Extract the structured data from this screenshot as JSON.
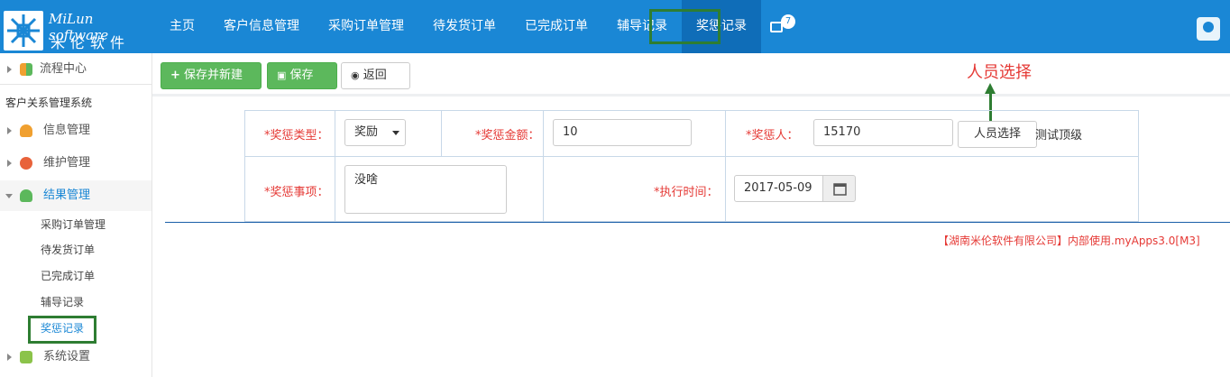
{
  "header": {
    "logo_en": "MiLun software",
    "logo_cn": "米伦软件",
    "nav": [
      "主页",
      "客户信息管理",
      "采购订单管理",
      "待发货订单",
      "已完成订单",
      "辅导记录",
      "奖惩记录"
    ],
    "badge_count": "7"
  },
  "sidebar": {
    "top_item": "流程中心",
    "section_title": "客户关系管理系统",
    "items": [
      "信息管理",
      "维护管理",
      "结果管理"
    ],
    "sub_items": [
      "采购订单管理",
      "待发货订单",
      "已完成订单",
      "辅导记录",
      "奖惩记录"
    ],
    "bottom_item": "系统设置"
  },
  "toolbar": {
    "save_new": "保存并新建",
    "save": "保存",
    "back": "返回"
  },
  "annotation": "人员选择",
  "form": {
    "type_label": "*奖惩类型：",
    "type_value": "奖励",
    "amount_label": "*奖惩金额：",
    "amount_value": "10",
    "person_label": "*奖惩人：",
    "person_value": "15170",
    "person_button": "人员选择",
    "person_name": "测试顶级",
    "matter_label": "*奖惩事项：",
    "matter_value": "没啥",
    "time_label": "*执行时间：",
    "time_value": "2017-05-09"
  },
  "footer": "【湖南米伦软件有限公司】内部使用.myApps3.0[M3]",
  "colors": {
    "topbar": "#1a87d5",
    "accent_green": "#5cb85c",
    "highlight_box": "#2e7d32",
    "required_red": "#e53935"
  }
}
